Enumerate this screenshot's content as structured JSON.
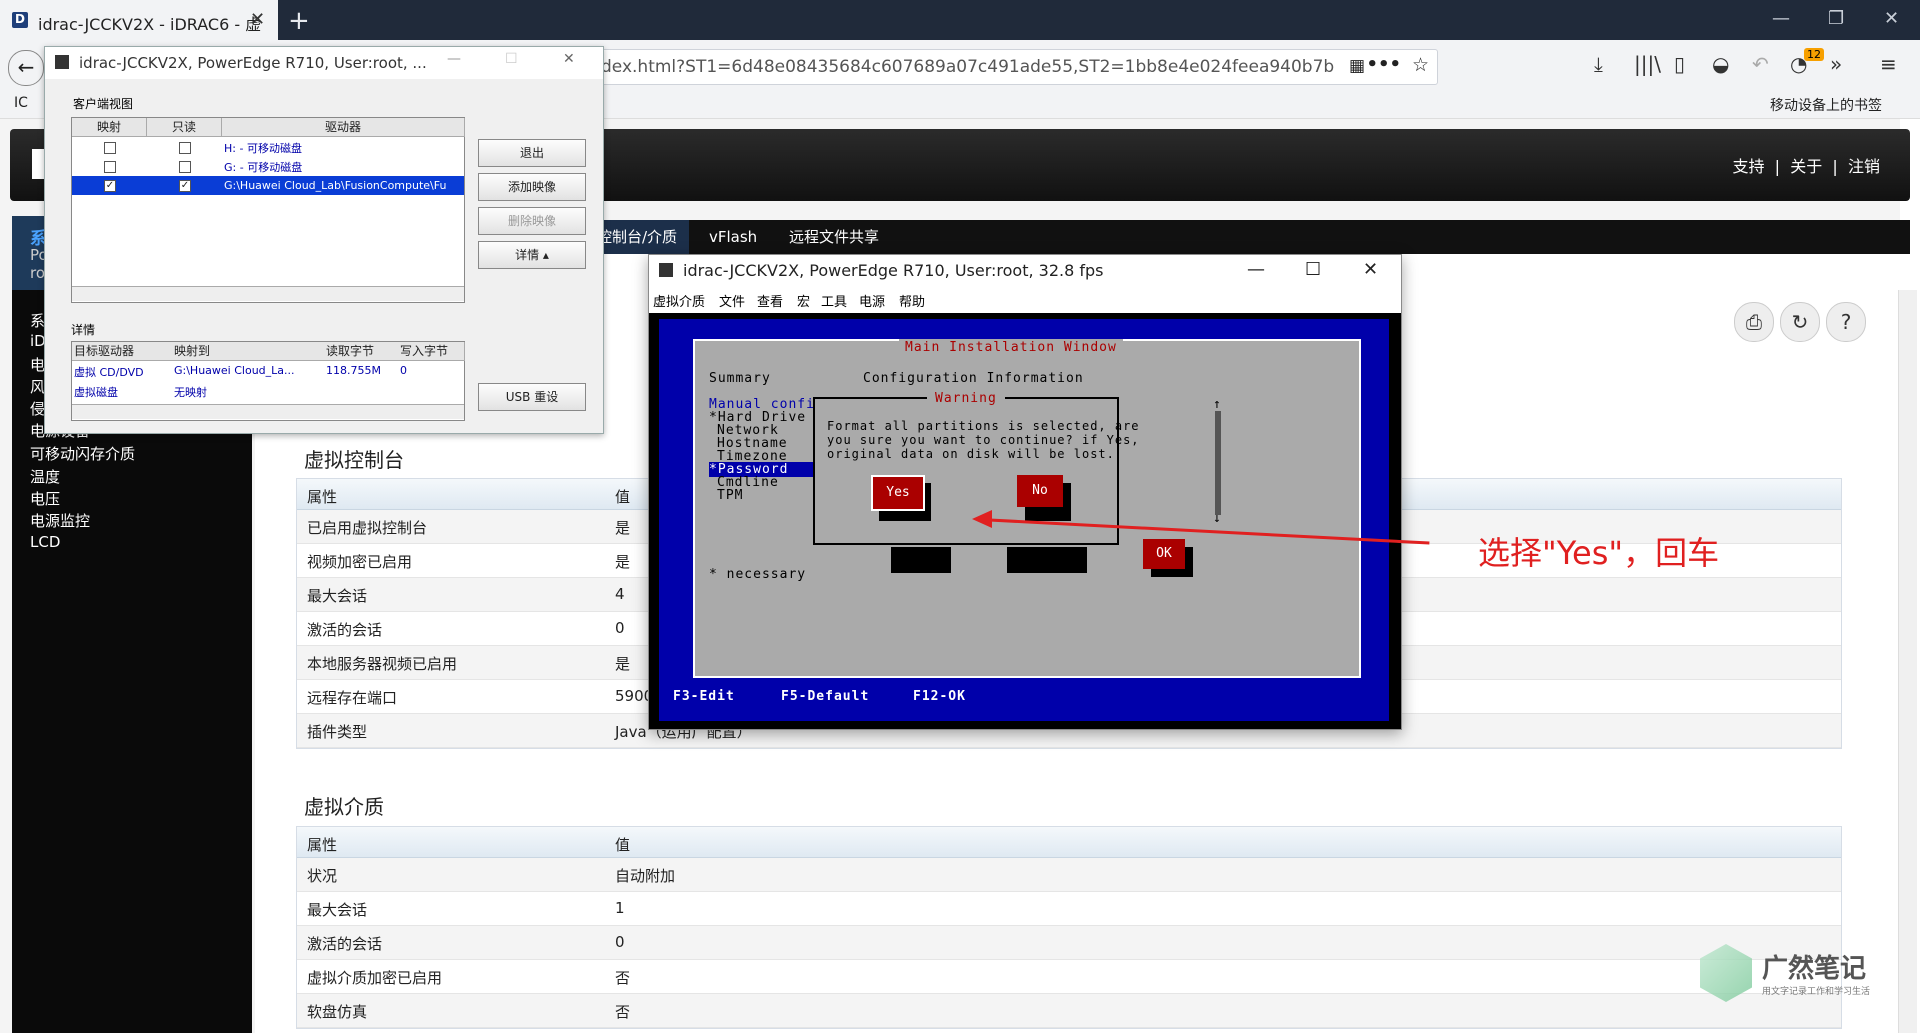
{
  "browser": {
    "tab_title": "idrac-JCCKV2X - iDRAC6 - 虚",
    "url": "dex.html?ST1=6d48e08435684c607689a07c491ade55,ST2=1bb8e4e024feea940b7b",
    "bookmark_right": "移动设备上的书签",
    "bookmark_left": "IC",
    "badge_count": "12"
  },
  "idrac": {
    "top_links": [
      "支持",
      "关于",
      "注销"
    ],
    "left_header": [
      "系",
      "Pov",
      "roo"
    ],
    "left_nav": [
      "系统",
      "iDF",
      "电池",
      "风扇",
      "侵入",
      "电源设备",
      "可移动闪存介质",
      "温度",
      "电压",
      "电源监控",
      "LCD"
    ],
    "tabs": [
      "控制台/介质",
      "vFlash",
      "远程文件共享"
    ],
    "console_section": {
      "title": "虚拟控制台",
      "header": [
        "属性",
        "值"
      ],
      "rows": [
        [
          "已启用虚拟控制台",
          "是"
        ],
        [
          "视频加密已启用",
          "是"
        ],
        [
          "最大会话",
          "4"
        ],
        [
          "激活的会话",
          "0"
        ],
        [
          "本地服务器视频已启用",
          "是"
        ],
        [
          "远程存在端口",
          "5900"
        ],
        [
          "插件类型",
          "Java（运用广配置）"
        ]
      ]
    },
    "media_section": {
      "title": "虚拟介质",
      "header": [
        "属性",
        "值"
      ],
      "rows": [
        [
          "状况",
          "自动附加"
        ],
        [
          "最大会话",
          "1"
        ],
        [
          "激活的会话",
          "0"
        ],
        [
          "虚拟介质加密已启用",
          "否"
        ],
        [
          "软盘仿真",
          "否"
        ]
      ]
    }
  },
  "vm_dialog": {
    "title": "idrac-JCCKV2X, PowerEdge R710, User:root, ...",
    "client_view_label": "客户端视图",
    "cols": [
      "映射",
      "只读",
      "驱动器"
    ],
    "drives": [
      {
        "mapped": false,
        "readonly": false,
        "name": "H: - 可移动磁盘"
      },
      {
        "mapped": false,
        "readonly": false,
        "name": "G: - 可移动磁盘"
      },
      {
        "mapped": true,
        "readonly": true,
        "name": "G:\\Huawei Cloud_Lab\\FusionCompute\\Fu"
      }
    ],
    "buttons": [
      "退出",
      "添加映像",
      "删除映像",
      "详情 ▴",
      "USB 重设"
    ],
    "details_label": "详情",
    "detail_cols": [
      "目标驱动器",
      "映射到",
      "读取字节",
      "写入字节"
    ],
    "detail_rows": [
      [
        "虚拟 CD/DVD",
        "G:\\Huawei Cloud_La...",
        "118.755M",
        "0"
      ],
      [
        "虚拟磁盘",
        "无映射",
        "",
        ""
      ]
    ]
  },
  "console": {
    "title": "idrac-JCCKV2X, PowerEdge R710, User:root, 32.8 fps",
    "menu": [
      "虚拟介质",
      "文件",
      "查看",
      "宏",
      "工具",
      "电源",
      "帮助"
    ],
    "main_title": "Main Installation Window",
    "summary": "Summary",
    "config_info": "Configuration Information",
    "steps": [
      "Manual config",
      "*Hard Drive",
      "Network",
      "Hostname",
      "Timezone",
      "*Password",
      "Cmdline",
      "TPM"
    ],
    "necessary": "* necessary",
    "warning_title": "Warning",
    "warning_text": [
      "Format all partitions is selected, are",
      "you sure you want to continue? if Yes,",
      "original data on disk will be lost."
    ],
    "yes": "Yes",
    "no": "No",
    "ok": "OK",
    "footer": [
      "F3-Edit",
      "F5-Default",
      "F12-OK"
    ]
  },
  "annotation": "选择\"Yes\"，回车",
  "watermark": {
    "title": "广然笔记",
    "subtitle": "用文字记录工作和学习生活"
  }
}
